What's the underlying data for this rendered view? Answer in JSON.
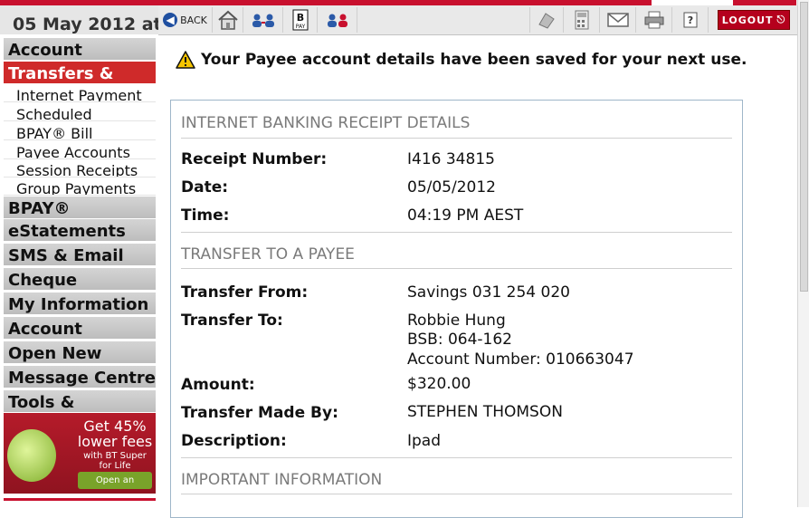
{
  "header": {
    "date_text": "05 May 2012 at",
    "back_label": "BACK",
    "logout_label": "LOGOUT",
    "bpay_label": "PAY"
  },
  "sidebar": {
    "items": [
      {
        "label": "Account",
        "type": "main"
      },
      {
        "label": "Transfers &",
        "type": "main",
        "active": true
      },
      {
        "label": "Internet Payment",
        "type": "sub"
      },
      {
        "label": "Scheduled",
        "type": "sub"
      },
      {
        "label": "BPAY® Bill",
        "type": "sub"
      },
      {
        "label": "Payee Accounts",
        "type": "sub"
      },
      {
        "label": "Session Receipts",
        "type": "sub"
      },
      {
        "label": "Group Payments",
        "type": "sub"
      },
      {
        "label": "BPAY®",
        "type": "main"
      },
      {
        "label": "eStatements",
        "type": "main"
      },
      {
        "label": "SMS & Email",
        "type": "main"
      },
      {
        "label": "Cheque",
        "type": "main"
      },
      {
        "label": "My Information",
        "type": "main"
      },
      {
        "label": "Account",
        "type": "main"
      },
      {
        "label": "Open New",
        "type": "main"
      },
      {
        "label": "Message Centre",
        "type": "main"
      },
      {
        "label": "Tools &",
        "type": "main"
      }
    ],
    "ad": {
      "headline": "Get 45% lower fees",
      "subline": "with BT Super for Life",
      "cta": "Open an account"
    }
  },
  "notice": {
    "text": "Your Payee account details have been saved for your next use."
  },
  "receipt": {
    "section1_title": "INTERNET BANKING RECEIPT DETAILS",
    "receipt_number_label": "Receipt Number:",
    "receipt_number": "I416 34815",
    "date_label": "Date:",
    "date": "05/05/2012",
    "time_label": "Time:",
    "time": "04:19 PM AEST",
    "section2_title": "TRANSFER TO A PAYEE",
    "from_label": "Transfer From:",
    "from": "Savings 031 254 020",
    "to_label": "Transfer To:",
    "to_name": "Robbie Hung",
    "to_bsb": "BSB: 064-162",
    "to_account": "Account Number: 010663047",
    "amount_label": "Amount:",
    "amount": "$320.00",
    "made_by_label": "Transfer Made By:",
    "made_by": "STEPHEN THOMSON",
    "description_label": "Description:",
    "description": "Ipad",
    "section3_title": "IMPORTANT INFORMATION"
  },
  "colors": {
    "brand_red": "#c8102e",
    "active_nav": "#cf2a2a",
    "nav_gray": "#c8c8c8",
    "receipt_border": "#9fb6c9"
  }
}
